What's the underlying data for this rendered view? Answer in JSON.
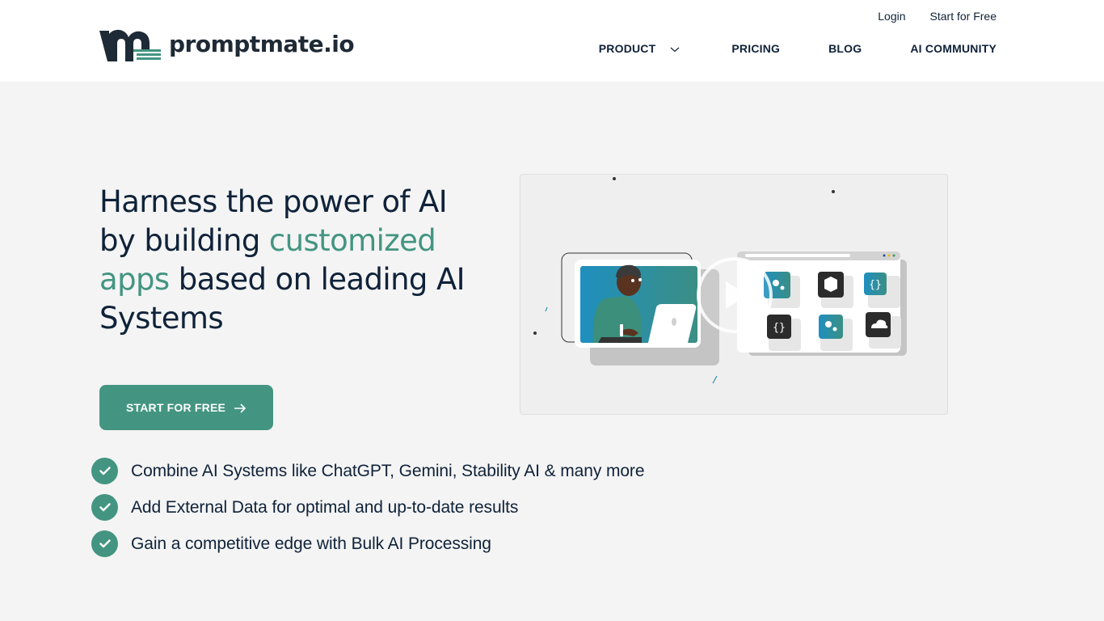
{
  "header": {
    "logo_text": "promptmate.io",
    "top_links": {
      "login": "Login",
      "start_free": "Start for Free"
    },
    "nav": {
      "product": "PRODUCT",
      "pricing": "PRICING",
      "blog": "BLOG",
      "community": "AI COMMUNITY"
    }
  },
  "hero": {
    "title_part1": "Harness the power of AI by building ",
    "title_accent": "customized apps",
    "title_part2": " based on leading AI Systems",
    "cta_label": "START FOR FREE",
    "features": [
      "Combine AI Systems like ChatGPT, Gemini, Stability AI & many more",
      "Add External Data for optimal and up-to-date results",
      "Gain a competitive edge with Bulk AI Processing"
    ]
  },
  "video": {
    "play_icon": "play-icon",
    "tiles": [
      "gears-icon",
      "box-icon",
      "code-link-icon",
      "code-link-icon",
      "gears-icon",
      "cloud-icon"
    ]
  },
  "colors": {
    "accent": "#439581",
    "text": "#0f2239",
    "background": "#f4f4f4",
    "header_bg": "#ffffff",
    "tile_teal": "#2a8fa8",
    "tile_dark": "#2b2b2b"
  }
}
